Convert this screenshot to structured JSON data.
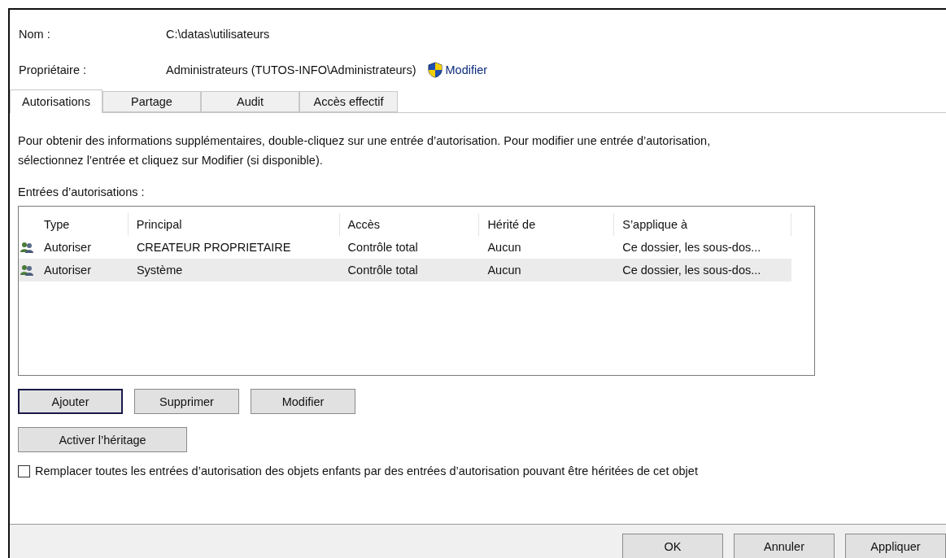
{
  "fields": [
    {
      "label": "Nom :",
      "value": "C:\\datas\\utilisateurs"
    },
    {
      "label": "Propriétaire :",
      "value": "Administrateurs (TUTOS-INFO\\Administrateurs)",
      "link": "Modifier"
    }
  ],
  "tabs": [
    {
      "label": "Autorisations",
      "selected": true
    },
    {
      "label": "Partage",
      "selected": false
    },
    {
      "label": "Audit",
      "selected": false
    },
    {
      "label": "Accès effectif",
      "selected": false
    }
  ],
  "description": [
    "Pour obtenir des informations supplémentaires, double-cliquez sur une entrée d’autorisation. Pour modifier une entrée d’autorisation,",
    "sélectionnez l’entrée et cliquez sur Modifier (si disponible)."
  ],
  "entries_label": "Entrées d’autorisations :",
  "table": {
    "columns": [
      "Type",
      "Principal",
      "Accès",
      "Hérité de",
      "S’applique à"
    ],
    "rows": [
      {
        "selected": false,
        "cells": [
          "Autoriser",
          "CREATEUR PROPRIETAIRE",
          "Contrôle total",
          "Aucun",
          "Ce dossier, les sous-dos..."
        ]
      },
      {
        "selected": true,
        "cells": [
          "Autoriser",
          "Système",
          "Contrôle total",
          "Aucun",
          "Ce dossier, les sous-dos..."
        ]
      }
    ]
  },
  "actions": [
    {
      "label": "Ajouter",
      "focused": true
    },
    {
      "label": "Supprimer",
      "focused": false
    },
    {
      "label": "Modifier",
      "focused": false
    }
  ],
  "inheritance_button": "Activer l’héritage",
  "replace_checkbox": {
    "label": "Remplacer toutes les entrées d’autorisation des objets enfants par des entrées d’autorisation pouvant être héritées de cet objet",
    "checked": false
  },
  "footer_buttons": [
    "OK",
    "Annuler",
    "Appliquer"
  ]
}
